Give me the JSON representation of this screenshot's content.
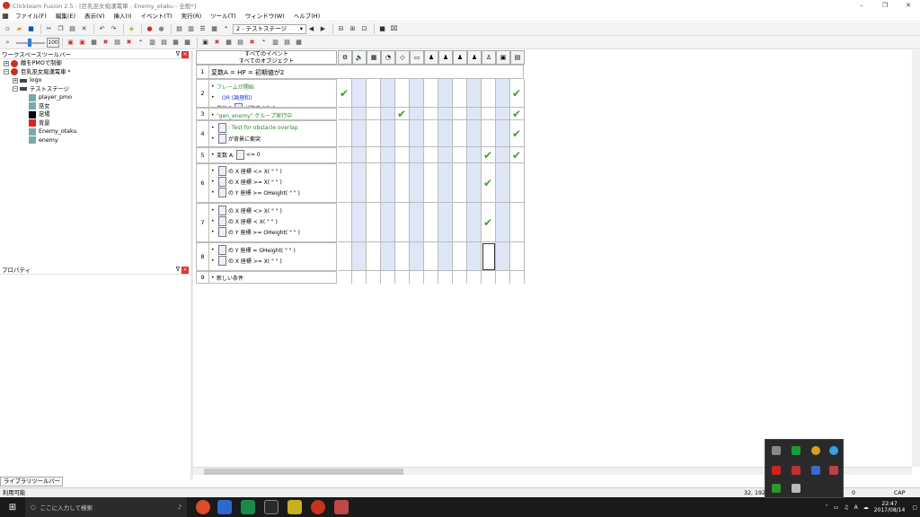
{
  "window": {
    "title": "Clickteam Fusion 2.5 - [巨乳巫女痴漢電車 - Enemy_otaku - 全般*]",
    "controls": [
      "–",
      "❐",
      "✕"
    ]
  },
  "menu": [
    "ファイル(F)",
    "編集(E)",
    "表示(V)",
    "挿入(I)",
    "イベント(T)",
    "実行(R)",
    "ツール(T)",
    "ウィンドウ(W)",
    "ヘルプ(H)"
  ],
  "toolbar": {
    "frame_combo": "2 - テストステージ",
    "zoom_value": "100"
  },
  "workspace": {
    "title": "ワークスペースツールバー",
    "pin": "ᐁ",
    "close": "×",
    "tree": [
      {
        "label": "敵をPMOで制御",
        "level": 0,
        "expander": "+",
        "icon": "app"
      },
      {
        "label": "巨乳巫女痴漢電車 *",
        "level": 0,
        "expander": "−",
        "icon": "app"
      },
      {
        "label": "logo",
        "level": 1,
        "expander": "+",
        "icon": "frame"
      },
      {
        "label": "テストステージ",
        "level": 1,
        "expander": "−",
        "icon": "frame"
      },
      {
        "label": "player_pmo",
        "level": 2,
        "expander": "",
        "icon": "sprite"
      },
      {
        "label": "巫女",
        "level": 2,
        "expander": "",
        "icon": "sprite"
      },
      {
        "label": "足場",
        "level": 2,
        "expander": "",
        "icon": "black"
      },
      {
        "label": "背景",
        "level": 2,
        "expander": "",
        "icon": "red"
      },
      {
        "label": "Enemy_otaku",
        "level": 2,
        "expander": "",
        "icon": "sprite"
      },
      {
        "label": "enemy",
        "level": 2,
        "expander": "",
        "icon": "sprite"
      }
    ]
  },
  "properties": {
    "title": "プロパティ",
    "pin": "ᐁ",
    "close": "×"
  },
  "library_tab": "ライブラリツールバー",
  "event_editor": {
    "header_line1": "すべてのイベント",
    "header_line2": "すべてのオブジェクト",
    "object_icons": [
      "gears-icon",
      "speaker-icon",
      "checker-icon",
      "timer-icon",
      "direction-icon",
      "keyboard-icon",
      "player-icon",
      "enemy-icon",
      "enemy2-icon",
      "enemy3-icon",
      "pmo-icon",
      "otaku-icon",
      "scene-icon"
    ],
    "rows": [
      {
        "num": "1",
        "type": "comment",
        "lines": [
          {
            "text": "変数A = HP = 初期値が2",
            "color": ""
          }
        ],
        "checks": []
      },
      {
        "num": "2",
        "lines": [
          {
            "text": "フレームが開始",
            "color": "green",
            "icon": false
          },
          {
            "text": "OR (論理和)",
            "color": "blue",
            "icon": false,
            "indent": true
          },
          {
            "text": "が破壊された",
            "color": "",
            "icon": true,
            "prefix": "最後の"
          }
        ],
        "checks": [
          0,
          12
        ]
      },
      {
        "num": "3",
        "lines": [
          {
            "text": "\"gen_enemy\" グループ実行中",
            "color": "green",
            "icon": false
          }
        ],
        "checks": [
          4,
          12
        ]
      },
      {
        "num": "4",
        "lines": [
          {
            "text": ": Test for obstacle overlap",
            "color": "green",
            "icon": true,
            "prefix": ""
          },
          {
            "text": "が背景に衝突",
            "color": "",
            "icon": true,
            "prefix": ""
          }
        ],
        "checks": [
          12
        ]
      },
      {
        "num": "5",
        "lines": [
          {
            "text": "<= 0",
            "color": "",
            "icon": true,
            "prefix": "変数 A:"
          }
        ],
        "checks": [
          10,
          12
        ]
      },
      {
        "num": "6",
        "lines": [
          {
            "text": "の X 座標 <> X( \" \" )",
            "color": "",
            "icon": true,
            "prefix": ""
          },
          {
            "text": "の X 座標 >= X( \" \" )",
            "color": "",
            "icon": true,
            "prefix": ""
          },
          {
            "text": "の Y 座標 >= OHeight( \" \" )",
            "color": "",
            "icon": true,
            "prefix": ""
          }
        ],
        "checks": [
          10
        ]
      },
      {
        "num": "7",
        "lines": [
          {
            "text": "の X 座標 <> X( \" \" )",
            "color": "",
            "icon": true,
            "prefix": ""
          },
          {
            "text": "の X 座標 < X( \" \" )",
            "color": "",
            "icon": true,
            "prefix": ""
          },
          {
            "text": "の Y 座標 >= OHeight( \" \" )",
            "color": "",
            "icon": true,
            "prefix": ""
          }
        ],
        "checks": [
          10
        ]
      },
      {
        "num": "8",
        "lines": [
          {
            "text": "の Y 座標 = OHeight( \" \" )",
            "color": "",
            "icon": true,
            "prefix": ""
          },
          {
            "text": "の X 座標 >= X( \" \" )",
            "color": "",
            "icon": true,
            "prefix": ""
          }
        ],
        "checks": [],
        "selected_col": 10
      },
      {
        "num": "9",
        "type": "new",
        "lines": [
          {
            "text": "新しい条件",
            "color": ""
          }
        ],
        "checks": []
      }
    ],
    "check_glyph": "✔"
  },
  "status": {
    "left": "利用可能",
    "coords": "32, 192",
    "count": "0",
    "right": "CAP NUM"
  },
  "taskbar": {
    "search_placeholder": "ここに入力して検索",
    "time": "22:47",
    "date": "2017/08/14",
    "ime": "A"
  },
  "colors": {
    "check": "#4a9a2a",
    "alt_col": "#dde7f5",
    "condition_green": "#2b8a2b",
    "condition_blue": "#1a40d0"
  }
}
